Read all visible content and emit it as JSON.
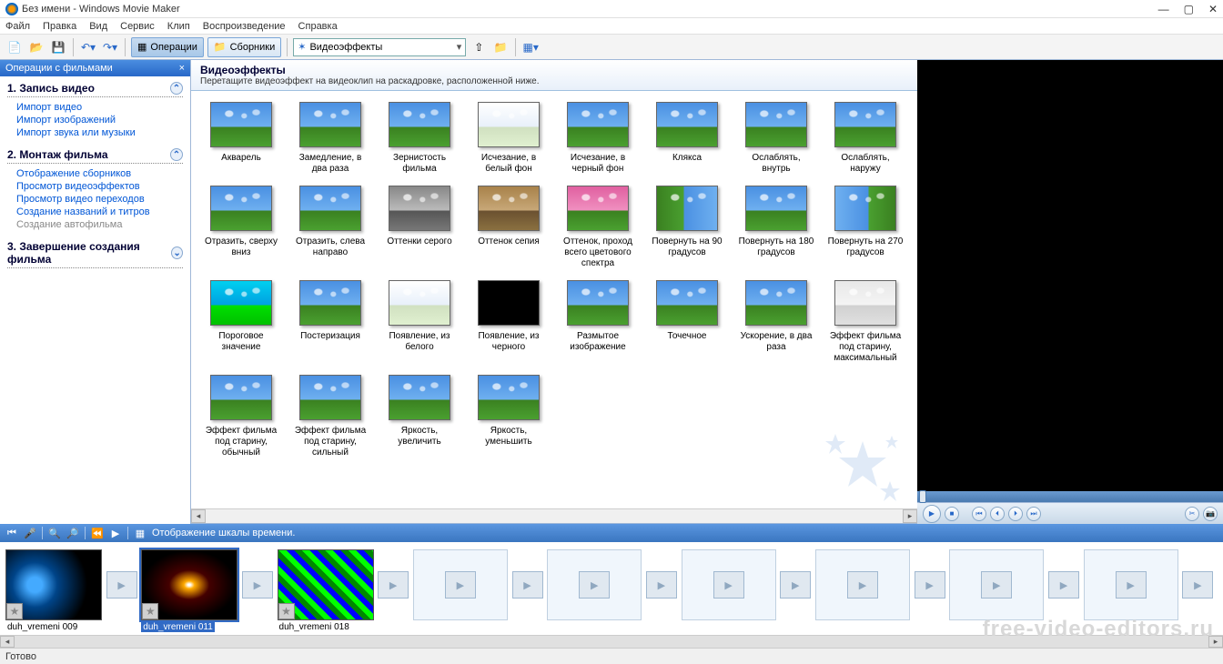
{
  "window": {
    "title": "Без имени - Windows Movie Maker"
  },
  "menu": [
    "Файл",
    "Правка",
    "Вид",
    "Сервис",
    "Клип",
    "Воспроизведение",
    "Справка"
  ],
  "toolbar": {
    "operations": "Операции",
    "collections": "Сборники",
    "combo": "Видеоэффекты"
  },
  "taskpane": {
    "title": "Операции с фильмами",
    "sec1": {
      "h": "1. Запись видео",
      "items": [
        "Импорт видео",
        "Импорт изображений",
        "Импорт звука или музыки"
      ]
    },
    "sec2": {
      "h": "2. Монтаж фильма",
      "items": [
        "Отображение сборников",
        "Просмотр видеоэффектов",
        "Просмотр видео переходов",
        "Создание названий и титров",
        "Создание автофильма"
      ]
    },
    "sec3": {
      "h": "3. Завершение создания фильма"
    }
  },
  "effects_header": {
    "title": "Видеоэффекты",
    "sub": "Перетащите видеоэффект на видеоклип на раскадровке, расположенной ниже."
  },
  "effects": [
    {
      "label": "Акварель",
      "cls": ""
    },
    {
      "label": "Замедление, в два раза",
      "cls": ""
    },
    {
      "label": "Зернистость фильма",
      "cls": ""
    },
    {
      "label": "Исчезание, в белый фон",
      "cls": "th-whiteout"
    },
    {
      "label": "Исчезание, в черный фон",
      "cls": ""
    },
    {
      "label": "Клякса",
      "cls": ""
    },
    {
      "label": "Ослаблять, внутрь",
      "cls": ""
    },
    {
      "label": "Ослаблять, наружу",
      "cls": ""
    },
    {
      "label": "Отразить, сверху вниз",
      "cls": ""
    },
    {
      "label": "Отразить, слева направо",
      "cls": ""
    },
    {
      "label": "Оттенки серого",
      "cls": "th-gray"
    },
    {
      "label": "Оттенок сепия",
      "cls": "th-sepia"
    },
    {
      "label": "Оттенок, проход всего цветового спектра",
      "cls": "th-pink"
    },
    {
      "label": "Повернуть на 90 градусов",
      "cls": "th-rot90"
    },
    {
      "label": "Повернуть на 180 градусов",
      "cls": ""
    },
    {
      "label": "Повернуть на 270 градусов",
      "cls": "th-rot270"
    },
    {
      "label": "Пороговое значение",
      "cls": "th-posterize"
    },
    {
      "label": "Постеризация",
      "cls": ""
    },
    {
      "label": "Появление, из белого",
      "cls": "th-whiteout"
    },
    {
      "label": "Появление, из черного",
      "cls": "th-dark"
    },
    {
      "label": "Размытое изображение",
      "cls": ""
    },
    {
      "label": "Точечное",
      "cls": ""
    },
    {
      "label": "Ускорение, в два раза",
      "cls": ""
    },
    {
      "label": "Эффект фильма под старину, максимальный",
      "cls": "th-aged"
    },
    {
      "label": "Эффект фильма под старину, обычный",
      "cls": ""
    },
    {
      "label": "Эффект фильма под старину, сильный",
      "cls": ""
    },
    {
      "label": "Яркость, увеличить",
      "cls": ""
    },
    {
      "label": "Яркость, уменьшить",
      "cls": ""
    }
  ],
  "timeline_bar": {
    "label": "Отображение шкалы времени."
  },
  "clips": [
    {
      "name": "duh_vremeni 009",
      "sel": false
    },
    {
      "name": "duh_vremeni 011",
      "sel": true
    },
    {
      "name": "duh_vremeni 018",
      "sel": false
    }
  ],
  "status": "Готово",
  "watermark_text": "free-video-editors.ru"
}
